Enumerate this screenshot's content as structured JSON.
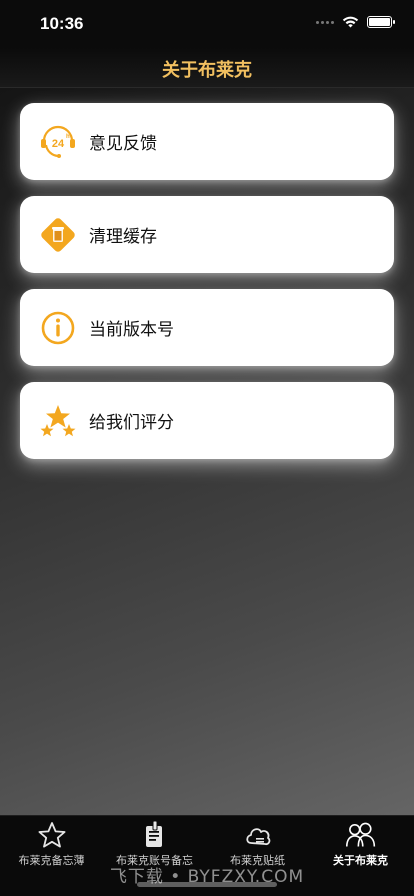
{
  "status": {
    "time": "10:36"
  },
  "nav": {
    "title": "关于布莱克"
  },
  "menu": [
    {
      "label": "意见反馈",
      "icon": "support-24h-icon"
    },
    {
      "label": "清理缓存",
      "icon": "clear-cache-icon"
    },
    {
      "label": "当前版本号",
      "icon": "info-icon"
    },
    {
      "label": "给我们评分",
      "icon": "rating-stars-icon"
    }
  ],
  "tabs": [
    {
      "label": "布莱克备忘薄",
      "icon": "star-outline-icon"
    },
    {
      "label": "布莱克账号备忘",
      "icon": "account-note-icon"
    },
    {
      "label": "布莱克贴纸",
      "icon": "sticker-icon"
    },
    {
      "label": "关于布莱克",
      "icon": "people-icon",
      "active": true
    }
  ],
  "watermark": "飞下载 • BYFZXY.COM",
  "colors": {
    "accent": "#f2c060",
    "icon_orange": "#f3a71f"
  }
}
